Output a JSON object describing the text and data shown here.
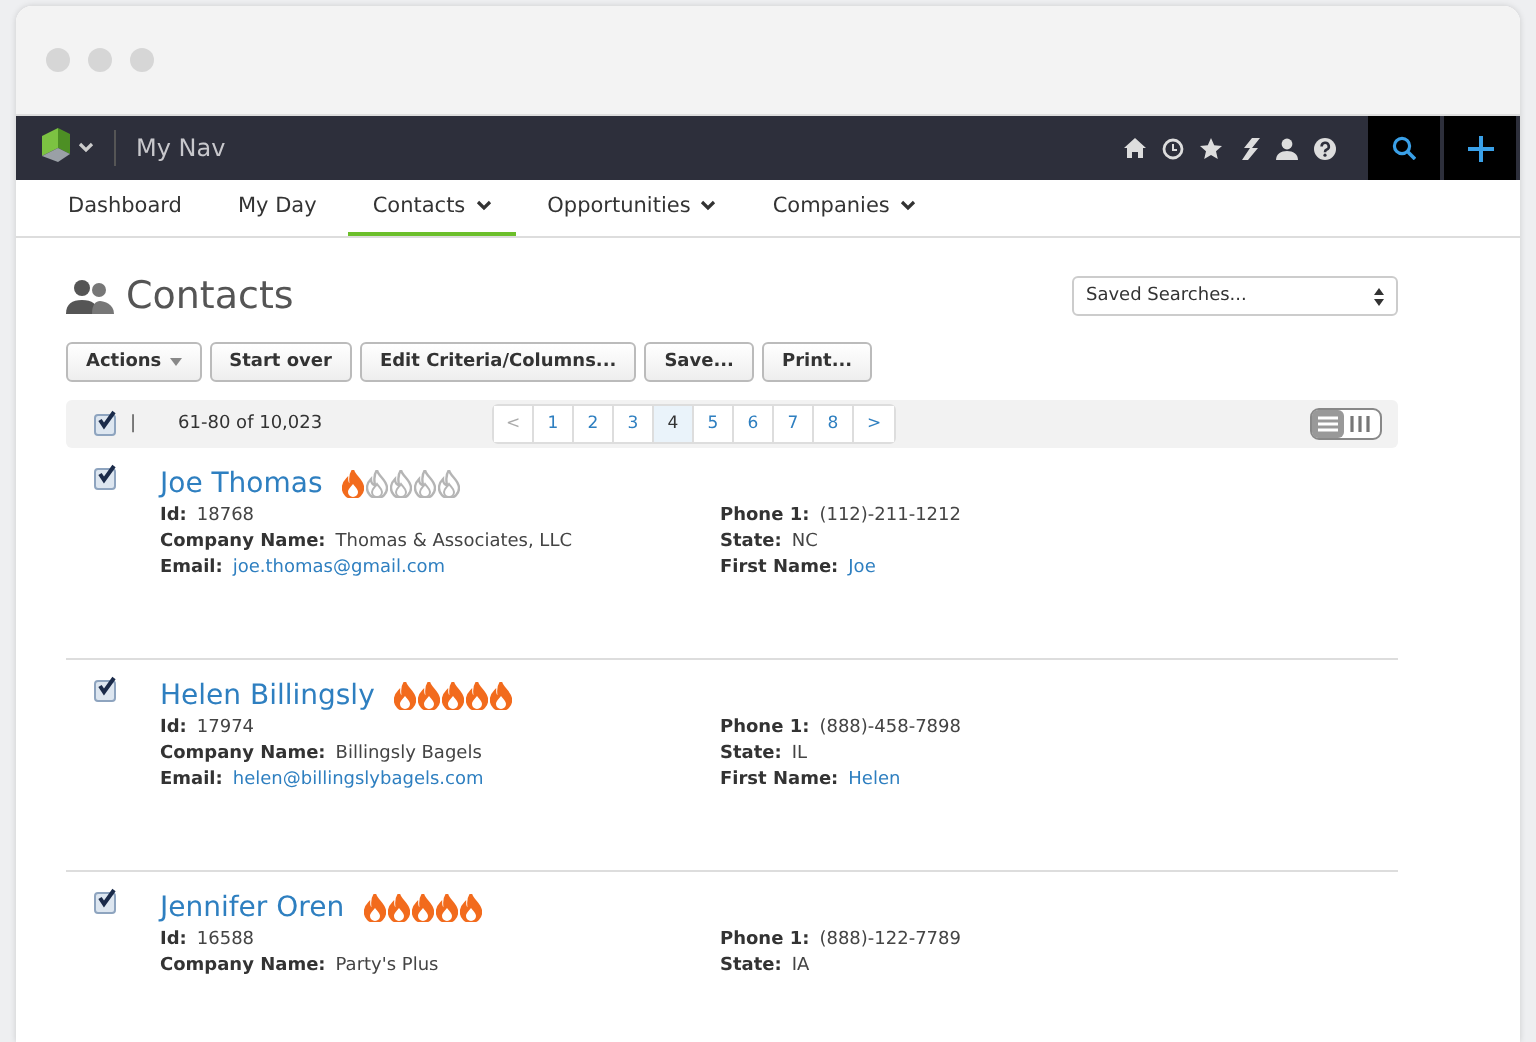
{
  "nav": {
    "title": "My Nav"
  },
  "tabs": [
    {
      "label": "Dashboard",
      "selected": false,
      "dropdown": false
    },
    {
      "label": "My Day",
      "selected": false,
      "dropdown": false
    },
    {
      "label": "Contacts",
      "selected": true,
      "dropdown": true
    },
    {
      "label": "Opportunities",
      "selected": false,
      "dropdown": true
    },
    {
      "label": "Companies",
      "selected": false,
      "dropdown": true
    }
  ],
  "page": {
    "title": "Contacts",
    "saved_searches": "Saved Searches..."
  },
  "toolbar": [
    {
      "label": "Actions",
      "dropdown": true
    },
    {
      "label": "Start over",
      "dropdown": false
    },
    {
      "label": "Edit Criteria/Columns...",
      "dropdown": false
    },
    {
      "label": "Save...",
      "dropdown": false
    },
    {
      "label": "Print...",
      "dropdown": false
    }
  ],
  "list_header": {
    "checked": true,
    "divider": "|",
    "range": "61-80 of 10,023"
  },
  "pagination": {
    "prev": "<",
    "next": ">",
    "pages": [
      {
        "label": "1",
        "selected": false
      },
      {
        "label": "2",
        "selected": false
      },
      {
        "label": "3",
        "selected": false
      },
      {
        "label": "4",
        "selected": true
      },
      {
        "label": "5",
        "selected": false
      },
      {
        "label": "6",
        "selected": false
      },
      {
        "label": "7",
        "selected": false
      },
      {
        "label": "8",
        "selected": false
      }
    ]
  },
  "contacts": [
    {
      "name": "Joe Thomas",
      "checked": true,
      "stars": 1,
      "left": [
        {
          "label": "Id:",
          "value": "18768",
          "kind": "text"
        },
        {
          "label": "Company Name:",
          "value": "Thomas & Associates, LLC",
          "kind": "text"
        },
        {
          "label": "Email:",
          "value": "joe.thomas@gmail.com",
          "kind": "link"
        }
      ],
      "right": [
        {
          "label": "Phone 1:",
          "value": "(112)-211-1212",
          "kind": "text"
        },
        {
          "label": "State:",
          "value": "NC",
          "kind": "text"
        },
        {
          "label": "First Name:",
          "value": "Joe",
          "kind": "link"
        }
      ]
    },
    {
      "name": "Helen Billingsly",
      "checked": true,
      "stars": 5,
      "left": [
        {
          "label": "Id:",
          "value": "17974",
          "kind": "text"
        },
        {
          "label": "Company Name:",
          "value": "Billingsly Bagels",
          "kind": "text"
        },
        {
          "label": "Email:",
          "value": "helen@billingslybagels.com",
          "kind": "link"
        }
      ],
      "right": [
        {
          "label": "Phone 1:",
          "value": "(888)-458-7898",
          "kind": "text"
        },
        {
          "label": "State:",
          "value": "IL",
          "kind": "text"
        },
        {
          "label": "First Name:",
          "value": "Helen",
          "kind": "link"
        }
      ]
    },
    {
      "name": "Jennifer Oren",
      "checked": true,
      "stars": 5,
      "left": [
        {
          "label": "Id:",
          "value": "16588",
          "kind": "text"
        },
        {
          "label": "Company Name:",
          "value": "Party's Plus",
          "kind": "text"
        }
      ],
      "right": [
        {
          "label": "Phone 1:",
          "value": "(888)-122-7789",
          "kind": "text"
        },
        {
          "label": "State:",
          "value": "IA",
          "kind": "text"
        }
      ]
    }
  ]
}
